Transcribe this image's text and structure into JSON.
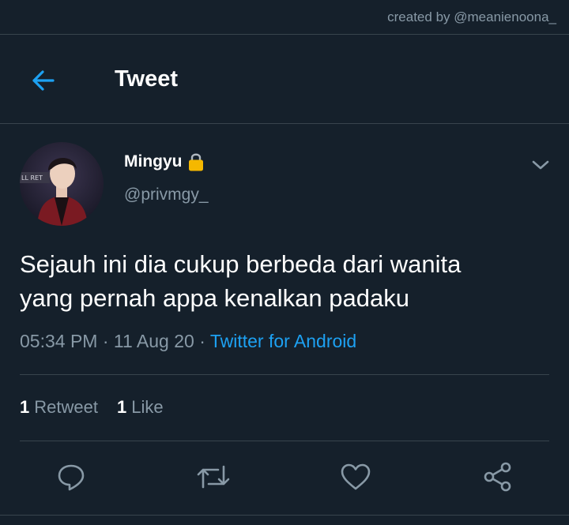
{
  "watermark": "created by @meanienoona_",
  "header": {
    "title": "Tweet",
    "back_icon": "arrow-left-icon"
  },
  "colors": {
    "background": "#15202b",
    "accent": "#1da1f2",
    "secondary_text": "#8899a6",
    "divider": "#38444d",
    "lock": "#f5b800"
  },
  "tweet": {
    "author": {
      "name": "Mingyu",
      "handle": "@privmgy_",
      "locked_icon": "lock-icon"
    },
    "text": "Sejauh ini dia cukup berbeda dari wanita\nyang pernah appa kenalkan padaku",
    "time": "05:34 PM",
    "date": "11 Aug 20",
    "source": "Twitter for Android",
    "stats": {
      "retweets_count": "1",
      "retweets_label": "Retweet",
      "likes_count": "1",
      "likes_label": "Like"
    },
    "actions": [
      "reply-icon",
      "retweet-icon",
      "like-icon",
      "share-icon"
    ]
  }
}
